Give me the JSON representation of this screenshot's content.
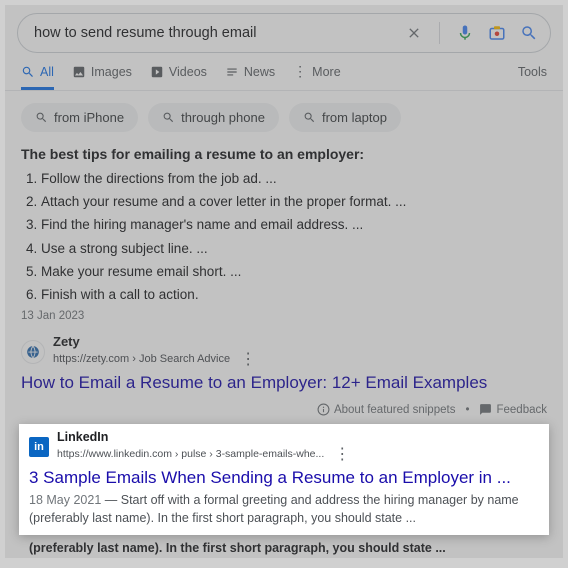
{
  "search": {
    "query": "how to send resume through email"
  },
  "tabs": {
    "all": "All",
    "images": "Images",
    "videos": "Videos",
    "news": "News",
    "more": "More",
    "tools": "Tools"
  },
  "chips": {
    "c1": "from iPhone",
    "c2": "through phone",
    "c3": "from laptop"
  },
  "featured": {
    "heading": "The best tips for emailing a resume to an employer:",
    "tips": [
      "Follow the directions from the job ad. ...",
      "Attach your resume and a cover letter in the proper format. ...",
      "Find the hiring manager's name and email address. ...",
      "Use a strong subject line. ...",
      "Make your resume email short. ...",
      "Finish with a call to action."
    ],
    "date": "13 Jan 2023",
    "source_name": "Zety",
    "source_url": "https://zety.com › Job Search Advice",
    "headline": "How to Email a Resume to an Employer: 12+ Email Examples",
    "about": "About featured snippets",
    "feedback": "Feedback"
  },
  "result1": {
    "source_name": "LinkedIn",
    "source_url": "https://www.linkedin.com › pulse › 3-sample-emails-whe...",
    "headline": "3 Sample Emails When Sending a Resume to an Employer in ...",
    "date": "18 May 2021",
    "desc": " — Start off with a formal greeting and address the hiring manager by name (preferably last name). In the first short paragraph, you should state ..."
  },
  "below": "(preferably last name). In the first short paragraph, you should state ..."
}
